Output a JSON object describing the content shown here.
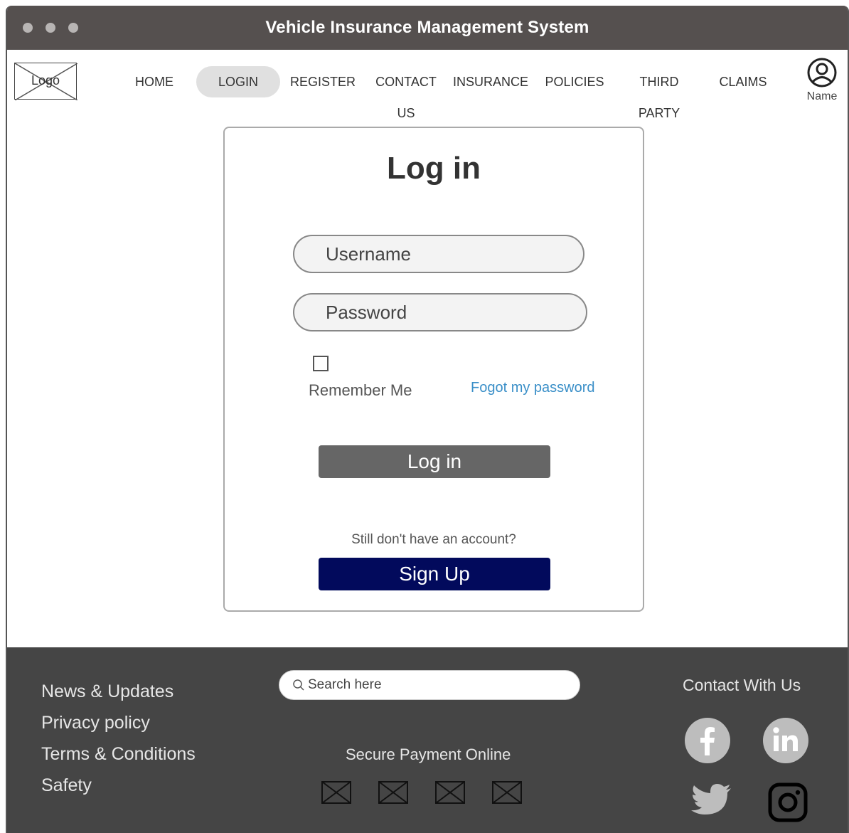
{
  "window": {
    "title": "Vehicle Insurance Management System"
  },
  "nav": {
    "logo_label": "Logo",
    "items": [
      {
        "label": "HOME"
      },
      {
        "label": "LOGIN"
      },
      {
        "label": "REGISTER"
      },
      {
        "label": "CONTACT US"
      },
      {
        "label": "INSURANCE"
      },
      {
        "label": "POLICIES"
      },
      {
        "label": "THIRD PARTY"
      },
      {
        "label": "CLAIMS"
      }
    ],
    "active_item": "LOGIN",
    "user_label": "Name"
  },
  "login": {
    "title": "Log in",
    "username_placeholder": "Username",
    "password_placeholder": "Password",
    "remember_label": "Remember Me",
    "forgot_label": "Fogot my password",
    "login_button": "Log in",
    "no_account_text": "Still don't have an account?",
    "signup_button": "Sign Up"
  },
  "footer": {
    "links": [
      {
        "label": "News & Updates"
      },
      {
        "label": "Privacy policy"
      },
      {
        "label": "Terms & Conditions"
      },
      {
        "label": "Safety"
      }
    ],
    "search_placeholder": "Search here",
    "secure_payment": "Secure Payment Online",
    "contact_title": "Contact With Us",
    "social_icons": [
      "facebook-icon",
      "linkedin-icon",
      "twitter-icon",
      "instagram-icon"
    ]
  },
  "colors": {
    "titlebar": "#55504f",
    "footer": "#454545",
    "signup": "#020a5c",
    "login_button": "#666666",
    "link": "#3a8fc8"
  }
}
